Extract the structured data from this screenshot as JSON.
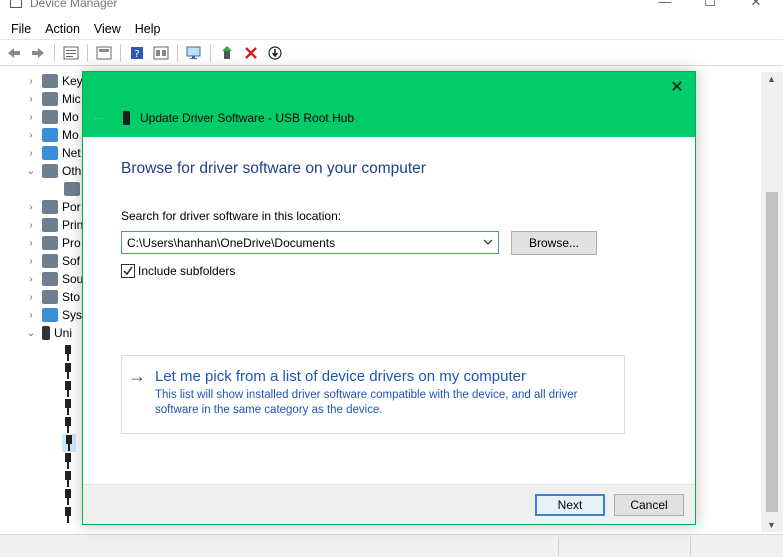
{
  "window": {
    "title": "Device Manager",
    "min_glyph": "—",
    "max_glyph": "☐",
    "close_glyph": "✕"
  },
  "menu": [
    "File",
    "Action",
    "View",
    "Help"
  ],
  "tree": {
    "rows": [
      {
        "label": "Key",
        "chev": "›"
      },
      {
        "label": "Mic",
        "chev": "›"
      },
      {
        "label": "Mo",
        "chev": "›"
      },
      {
        "label": "Mo",
        "chev": "›"
      },
      {
        "label": "Net",
        "chev": "›"
      },
      {
        "label": "Oth",
        "chev": "⌄"
      },
      {
        "label": "",
        "chev": ""
      },
      {
        "label": "Por",
        "chev": "›"
      },
      {
        "label": "Prin",
        "chev": "›"
      },
      {
        "label": "Pro",
        "chev": "›"
      },
      {
        "label": "Sof",
        "chev": "›"
      },
      {
        "label": "Sou",
        "chev": "›"
      },
      {
        "label": "Sto",
        "chev": "›"
      },
      {
        "label": "Syst",
        "chev": "›"
      },
      {
        "label": "Uni",
        "chev": "⌄"
      }
    ]
  },
  "dialog": {
    "title": "Update Driver Software - USB Root Hub",
    "close_glyph": "✕",
    "back_glyph": "←",
    "heading": "Browse for driver software on your computer",
    "search_label": "Search for driver software in this location:",
    "path_value": "C:\\Users\\hanhan\\OneDrive\\Documents",
    "browse_label": "Browse...",
    "include_subfolders_label": "Include subfolders",
    "include_subfolders_checked": true,
    "pick_arrow": "→",
    "pick_title": "Let me pick from a list of device drivers on my computer",
    "pick_desc": "This list will show installed driver software compatible with the device, and all driver software in the same category as the device.",
    "next_label": "Next",
    "cancel_label": "Cancel"
  },
  "colors": {
    "dialog_header": "#00cc6a",
    "link_blue": "#1f55b4",
    "heading_blue": "#1f3f8c"
  }
}
